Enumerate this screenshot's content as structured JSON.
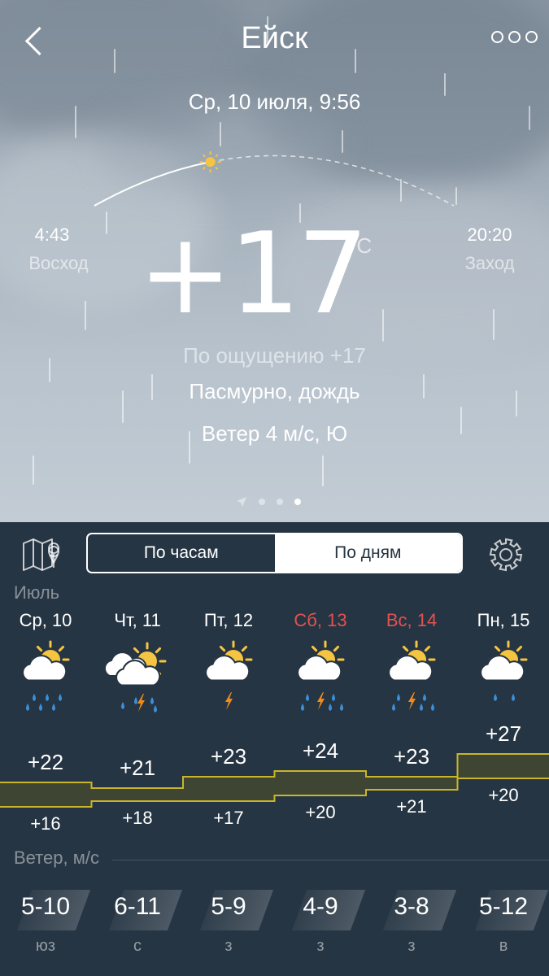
{
  "header": {
    "city": "Ейск",
    "date": "Ср, 10 июля, 9:56"
  },
  "sun": {
    "sunrise_time": "4:43",
    "sunrise_label": "Восход",
    "sunset_time": "20:20",
    "sunset_label": "Заход",
    "day_progress": 0.33
  },
  "current": {
    "temp": "+17",
    "unit": "°C",
    "feels_like": "По ощущению +17",
    "condition": "Пасмурно, дождь",
    "wind": "Ветер 4 м/с, Ю"
  },
  "pager": {
    "pages": 3,
    "active": 2
  },
  "tabs": {
    "hours": "По часам",
    "days": "По дням",
    "active": "days"
  },
  "month": "Июль",
  "days": [
    {
      "label": "Ср, 10",
      "weekend": false,
      "icon": "sun-cloud-rain-icon",
      "max": "+22",
      "min": "+16",
      "wind_speed": "5-10",
      "wind_dir": "юз"
    },
    {
      "label": "Чт, 11",
      "weekend": false,
      "icon": "sun-clouds-thunder-rain-icon",
      "max": "+21",
      "min": "+18",
      "wind_speed": "6-11",
      "wind_dir": "с"
    },
    {
      "label": "Пт, 12",
      "weekend": false,
      "icon": "sun-cloud-thunder-icon",
      "max": "+23",
      "min": "+17",
      "wind_speed": "5-9",
      "wind_dir": "з"
    },
    {
      "label": "Сб, 13",
      "weekend": true,
      "icon": "sun-cloud-thunder-rain-icon",
      "max": "+24",
      "min": "+20",
      "wind_speed": "4-9",
      "wind_dir": "з"
    },
    {
      "label": "Вс, 14",
      "weekend": true,
      "icon": "sun-cloud-thunder-rain-icon",
      "max": "+23",
      "min": "+21",
      "wind_speed": "3-8",
      "wind_dir": "з"
    },
    {
      "label": "Пн, 15",
      "weekend": false,
      "icon": "sun-cloud-light-rain-icon",
      "max": "+27",
      "min": "+20",
      "wind_speed": "5-12",
      "wind_dir": "в"
    }
  ],
  "wind_title": "Ветер, м/с",
  "colors": {
    "panel": "#263543",
    "weekend": "#e2524f",
    "sun": "#f5c542",
    "rain": "#3b8fd9",
    "bolt": "#f08a1c",
    "band_fill": "#3e4533",
    "band_stroke": "#c9b52a"
  }
}
